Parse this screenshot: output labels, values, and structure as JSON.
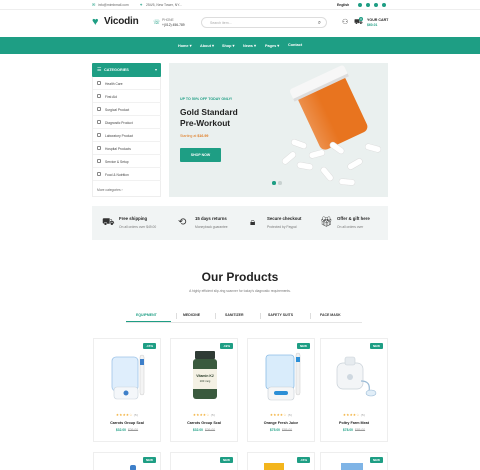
{
  "topbar": {
    "email": "info@mimbmail.com",
    "address": "254/5, New Tower, NY...",
    "language": "English",
    "social_icons": [
      "facebook-icon",
      "twitter-icon",
      "instagram-icon",
      "pinterest-icon"
    ]
  },
  "header": {
    "logo_text": "Vicodin",
    "phone_label": "PHONE",
    "phone_number": "+(012) 456-789",
    "search_placeholder": "Search item...",
    "cart_title": "YOUR CART",
    "cart_total": "$60.01",
    "cart_count": "0"
  },
  "nav": {
    "items": [
      "Home",
      "About",
      "Shop",
      "News",
      "Pages",
      "Contact"
    ]
  },
  "sidebar": {
    "title": "CATEGORIES",
    "items": [
      "Health Care",
      "First Aid",
      "Surgical Product",
      "Diagnostic Product",
      "Laboratory Product",
      "Hospital Products",
      "Service & Setup",
      "Food & Nutrition"
    ],
    "more": "More categories"
  },
  "hero": {
    "promo": "UP TO 50% OFF TODAY ONLY!",
    "headline_1": "Gold Standard",
    "headline_2": "Pre-Workout",
    "price_prefix": "Starting at",
    "price": "$16.99",
    "button": "SHOP NOW"
  },
  "features": [
    {
      "icon": "truck-icon",
      "title": "Free shipping",
      "sub": "On all orders over $49.00"
    },
    {
      "icon": "return-icon",
      "title": "15 days returns",
      "sub": "Moneyback guarantee"
    },
    {
      "icon": "lock-icon",
      "title": "Secure checkout",
      "sub": "Protected by Paypal"
    },
    {
      "icon": "gift-icon",
      "title": "Offer & gift here",
      "sub": "On all orders over"
    }
  ],
  "products_section": {
    "title": "Our Products",
    "subtitle": "A highly efficient slip-ring scanner for today's diagnostic requirements.",
    "tabs": [
      "EQUIPMENT",
      "MEDICINE",
      "SANITIZER",
      "SAFETY SUITS",
      "FACE MASK"
    ],
    "active_tab": "EQUIPMENT"
  },
  "products": [
    {
      "name": "Carrots Group Scal",
      "badge": "-15%",
      "rating": 4,
      "reviews": "(5)",
      "price": "$32.00",
      "old_price": "$36.00",
      "image": "water-flosser-icon"
    },
    {
      "name": "Carrots Group Scal",
      "badge": "-19%",
      "rating": 4,
      "reviews": "(5)",
      "price": "$32.00",
      "old_price": "$36.00",
      "image": "vitamin-bottle-icon"
    },
    {
      "name": "Orange Fresh Juice",
      "badge": "NEW",
      "rating": 4,
      "reviews": "(5)",
      "price": "$75.00",
      "old_price": "$85.00",
      "image": "oral-irrigator-icon"
    },
    {
      "name": "Poltry Farm Meat",
      "badge": "NEW",
      "rating": 4,
      "reviews": "(5)",
      "price": "$78.00",
      "old_price": "$85.00",
      "image": "nebulizer-icon"
    }
  ],
  "products_row2_badges": [
    "NEW",
    "NEW",
    "-15%",
    "NEW"
  ]
}
